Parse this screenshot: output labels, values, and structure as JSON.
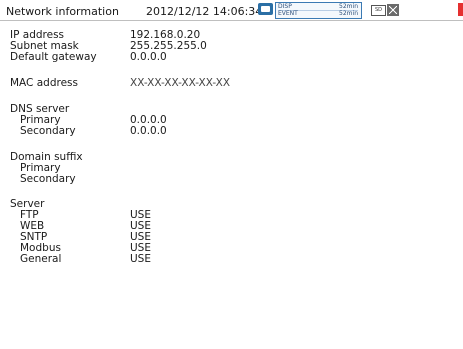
{
  "header": {
    "title": "Network information",
    "datetime": "2012/12/12 14:06:34",
    "memory": {
      "disp_label": "DISP",
      "disp_value": "52min",
      "event_label": "EVENT",
      "event_value": "52min"
    },
    "sd_label": "SD"
  },
  "network": {
    "ip_label": "IP address",
    "ip_value": "192.168.0.20",
    "subnet_label": "Subnet mask",
    "subnet_value": "255.255.255.0",
    "gateway_label": "Default gateway",
    "gateway_value": "0.0.0.0",
    "mac_label": "MAC address",
    "mac_value": "XX-XX-XX-XX-XX-XX"
  },
  "dns": {
    "heading": "DNS server",
    "primary_label": "Primary",
    "primary_value": "0.0.0.0",
    "secondary_label": "Secondary",
    "secondary_value": "0.0.0.0"
  },
  "domain_suffix": {
    "heading": "Domain suffix",
    "primary_label": "Primary",
    "secondary_label": "Secondary"
  },
  "server": {
    "heading": "Server",
    "items": [
      {
        "label": "FTP",
        "value": "USE"
      },
      {
        "label": "WEB",
        "value": "USE"
      },
      {
        "label": "SNTP",
        "value": "USE"
      },
      {
        "label": "Modbus",
        "value": "USE"
      },
      {
        "label": "General",
        "value": "USE"
      }
    ]
  },
  "colors": {
    "memory_icon": "#2b6fa5",
    "alarm": "#e53030"
  }
}
